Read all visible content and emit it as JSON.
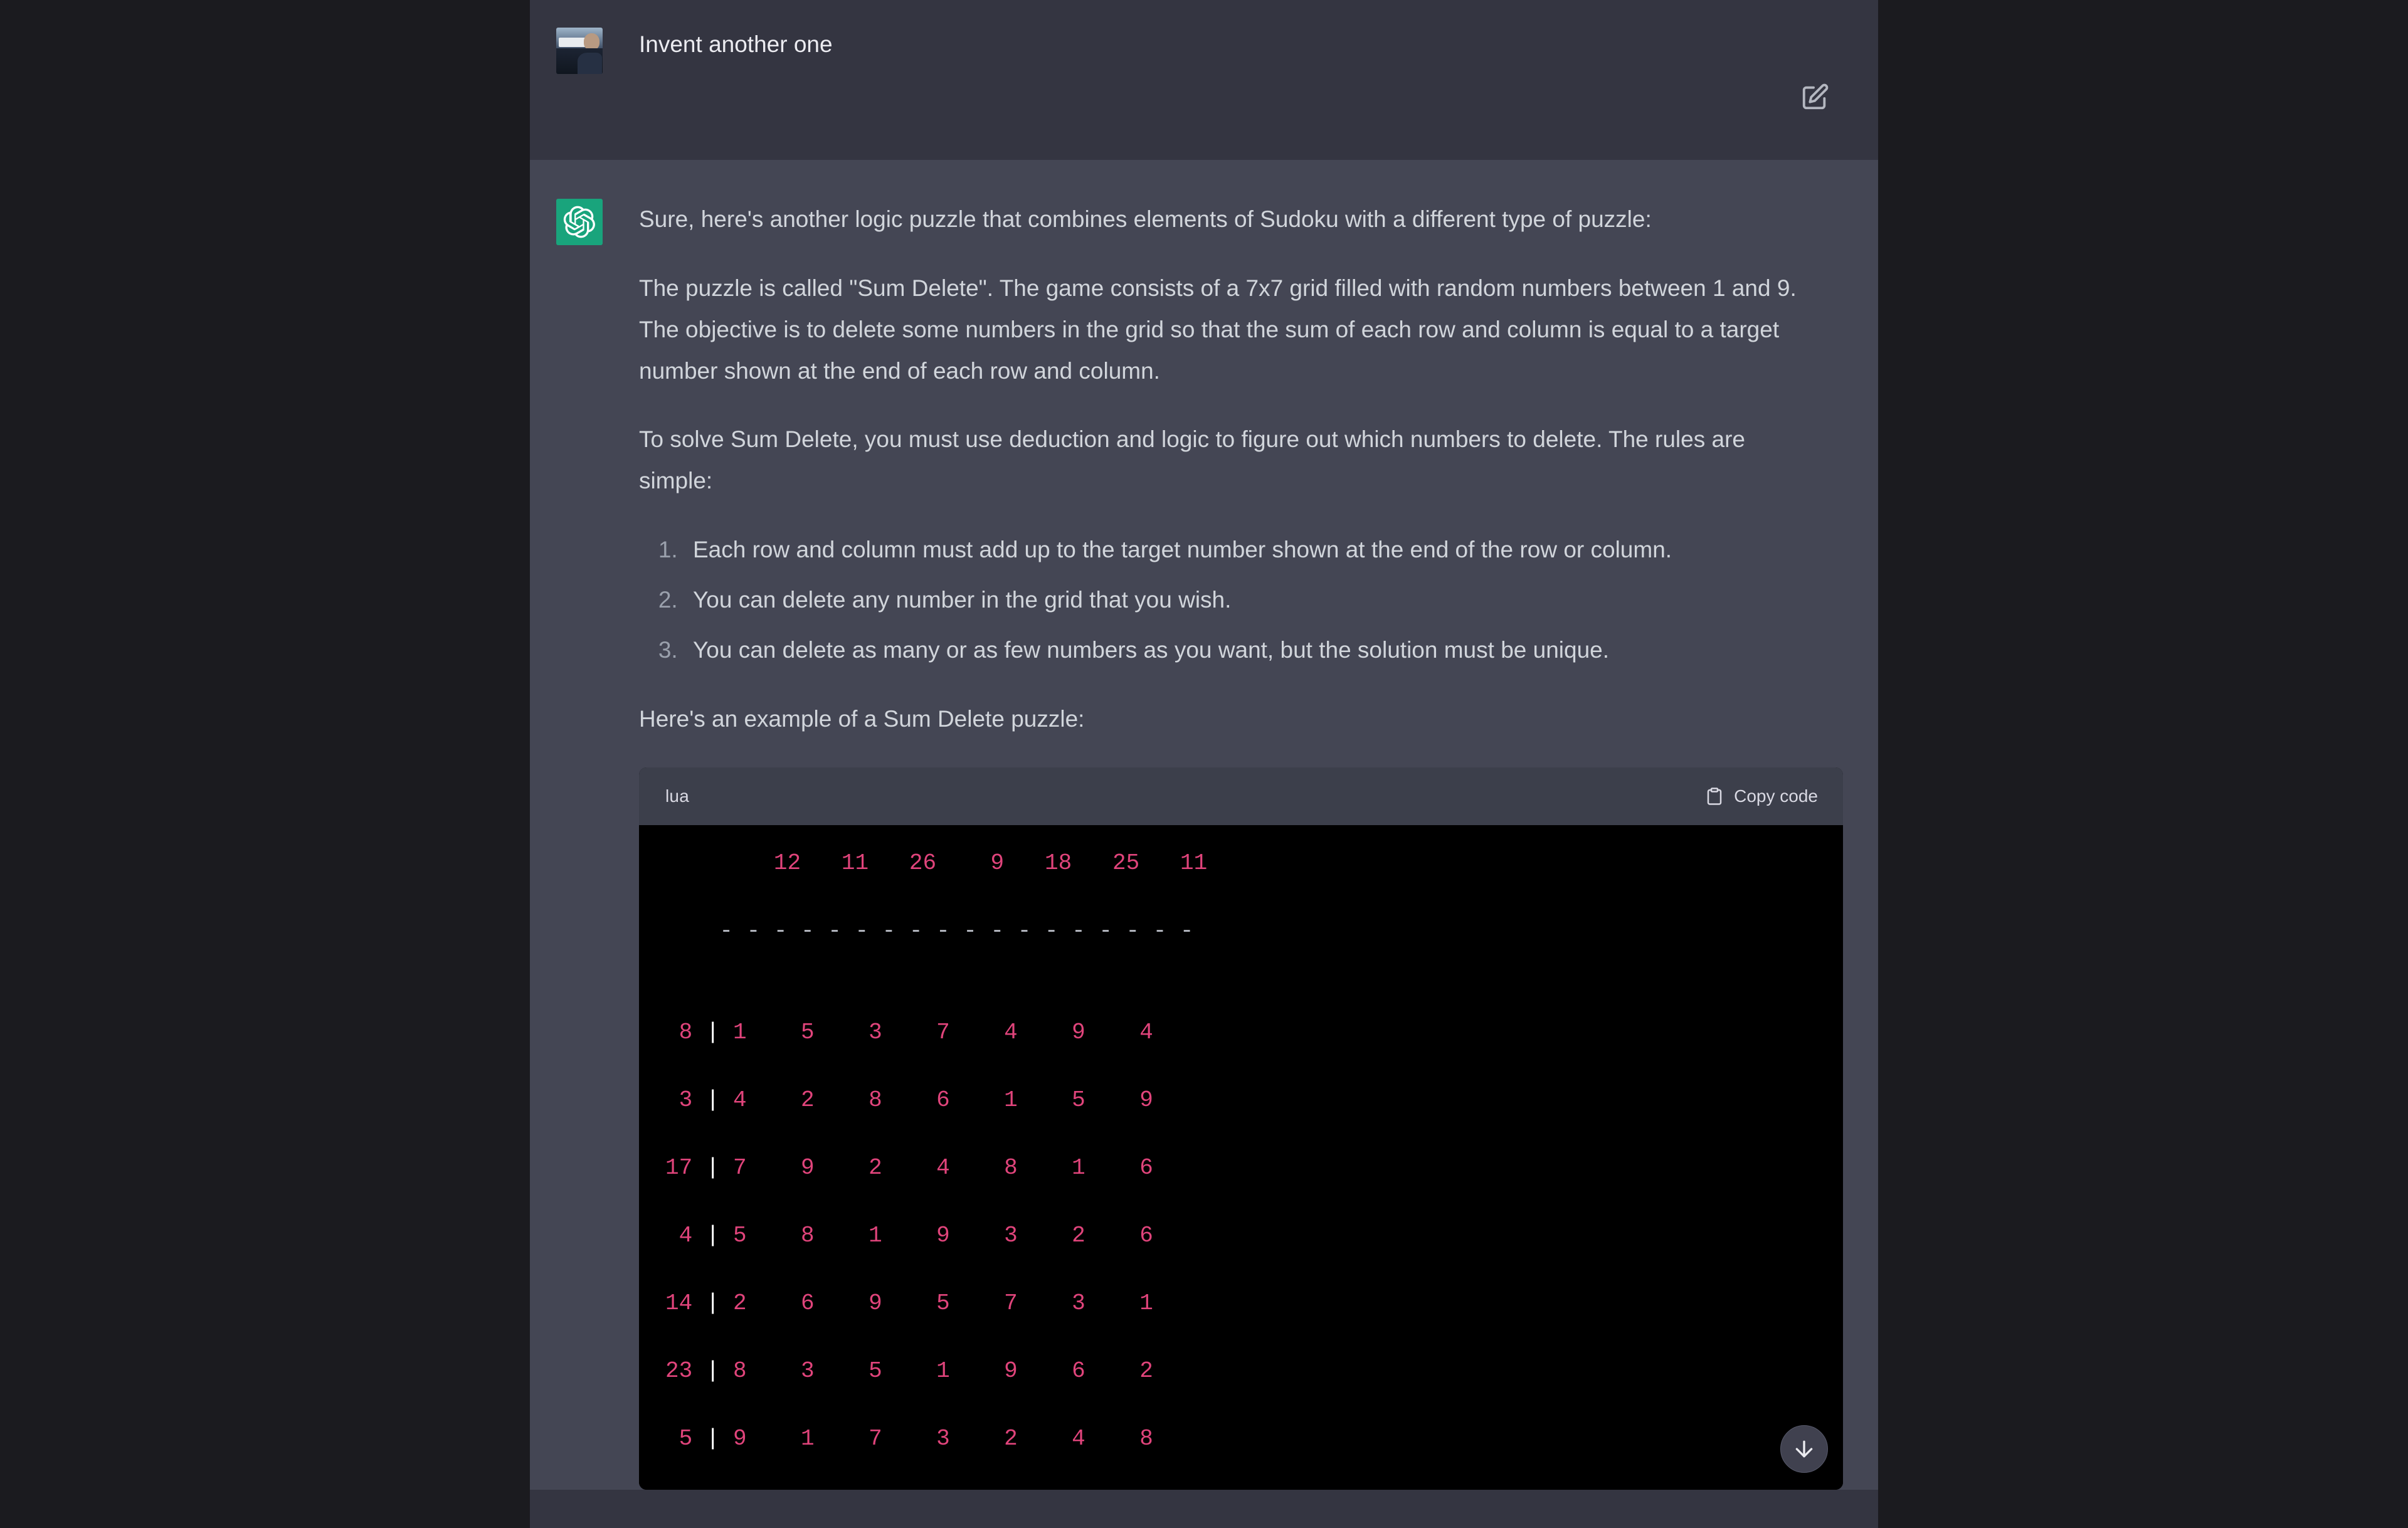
{
  "conversation": {
    "user_message": {
      "author": "user",
      "avatar_icon": "user-photo-avatar",
      "text": "Invent another one",
      "edit_icon": "edit-pencil-square-icon"
    },
    "assistant_message": {
      "author": "assistant",
      "avatar_icon": "openai-logo-icon",
      "paragraphs": [
        "Sure, here's another logic puzzle that combines elements of Sudoku with a different type of puzzle:",
        "The puzzle is called \"Sum Delete\". The game consists of a 7x7 grid filled with random numbers between 1 and 9. The objective is to delete some numbers in the grid so that the sum of each row and column is equal to a target number shown at the end of each row and column.",
        "To solve Sum Delete, you must use deduction and logic to figure out which numbers to delete. The rules are simple:"
      ],
      "rules": [
        "Each row and column must add up to the target number shown at the end of the row or column.",
        "You can delete any number in the grid that you wish.",
        "You can delete as many or as few numbers as you want, but the solution must be unique."
      ],
      "example_intro": "Here's an example of a Sum Delete puzzle:",
      "code_block": {
        "language": "lua",
        "copy_label": "Copy code",
        "copy_icon": "clipboard-icon",
        "column_targets": [
          "12",
          "11",
          "26",
          "9",
          "18",
          "25",
          "11"
        ],
        "separator": "-----------------------",
        "rows": [
          {
            "target": "8",
            "cells": [
              "1",
              "5",
              "3",
              "7",
              "4",
              "9",
              "4"
            ]
          },
          {
            "target": "3",
            "cells": [
              "4",
              "2",
              "8",
              "6",
              "1",
              "5",
              "9"
            ]
          },
          {
            "target": "17",
            "cells": [
              "7",
              "9",
              "2",
              "4",
              "8",
              "1",
              "6"
            ]
          },
          {
            "target": "4",
            "cells": [
              "5",
              "8",
              "1",
              "9",
              "3",
              "2",
              "6"
            ]
          },
          {
            "target": "14",
            "cells": [
              "2",
              "6",
              "9",
              "5",
              "7",
              "3",
              "1"
            ]
          },
          {
            "target": "23",
            "cells": [
              "8",
              "3",
              "5",
              "1",
              "9",
              "6",
              "2"
            ]
          },
          {
            "target": "5",
            "cells": [
              "9",
              "1",
              "7",
              "3",
              "2",
              "4",
              "8"
            ]
          }
        ]
      }
    }
  },
  "controls": {
    "scroll_to_bottom_icon": "arrow-down-icon"
  },
  "colors": {
    "page_background": "#1b1b1f",
    "user_row_background": "#343541",
    "assistant_row_background": "#444654",
    "code_header_background": "#3c3f4b",
    "code_body_background": "#000000",
    "code_number_color": "#e0447b",
    "code_separator_color": "#b9bdc6",
    "code_pipe_color": "#ffffff",
    "brand_green": "#19a47c",
    "body_text_color": "#d1d5db"
  }
}
